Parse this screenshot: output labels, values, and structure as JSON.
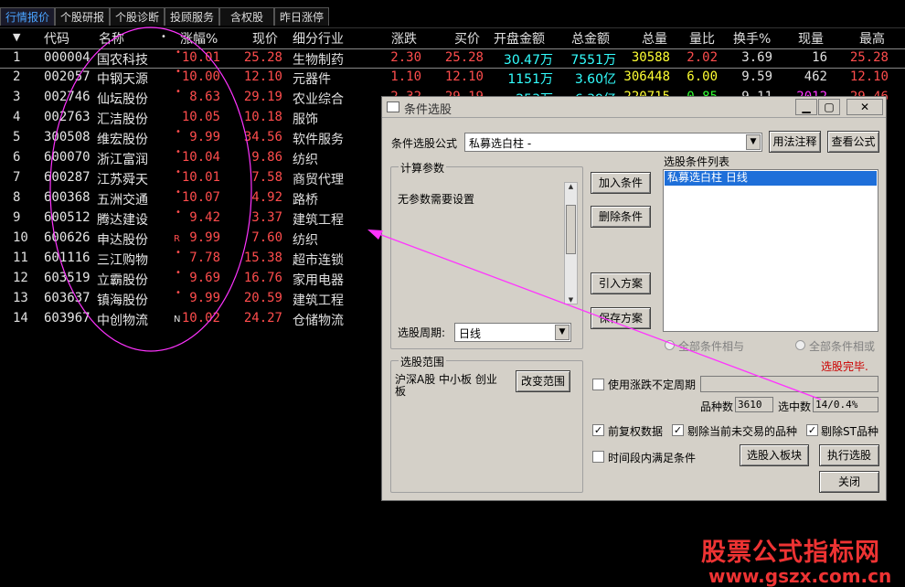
{
  "tabs": [
    {
      "label": "行情报价",
      "active": true
    },
    {
      "label": "个股研报",
      "active": false
    },
    {
      "label": "个股诊断",
      "active": false
    },
    {
      "label": "投顾服务",
      "active": false
    },
    {
      "label": "含权股",
      "active": false
    },
    {
      "label": "昨日涨停",
      "active": false
    }
  ],
  "table": {
    "headers": {
      "sort": "▼",
      "code": "代码",
      "name": "名称",
      "dot": "•",
      "pct": "涨幅%",
      "price": "现价",
      "industry": "细分行业",
      "chg": "涨跌",
      "bid": "买价",
      "open_amt": "开盘金额",
      "total_amt": "总金额",
      "volume": "总量",
      "vol_ratio": "量比",
      "turnover": "换手%",
      "cur_vol": "现量",
      "high": "最高"
    },
    "rows": [
      {
        "idx": "1",
        "code": "000004",
        "name": "国农科技",
        "mark": "•",
        "pct": "10.01",
        "price": "25.28",
        "industry": "生物制药",
        "chg": "2.30",
        "bid": "25.28",
        "open_amt": "30.47万",
        "total_amt": "7551万",
        "volume": "30588",
        "vol_ratio": "2.02",
        "turnover": "3.69",
        "cur_vol": "16",
        "high": "25.28"
      },
      {
        "idx": "2",
        "code": "002057",
        "name": "中钢天源",
        "mark": "•",
        "pct": "10.00",
        "price": "12.10",
        "industry": "元器件",
        "chg": "1.10",
        "bid": "12.10",
        "open_amt": "1151万",
        "total_amt": "3.60亿",
        "volume": "306448",
        "vol_ratio": "6.00",
        "turnover": "9.59",
        "cur_vol": "462",
        "high": "12.10"
      },
      {
        "idx": "3",
        "code": "002746",
        "name": "仙坛股份",
        "mark": "•",
        "pct": "8.63",
        "price": "29.19",
        "industry": "农业综合",
        "chg": "2.32",
        "bid": "29.19",
        "open_amt": "253万",
        "total_amt": "6.39亿",
        "volume": "220715",
        "vol_ratio": "0.85",
        "turnover": "9.11",
        "cur_vol": "2012",
        "high": "29.46"
      },
      {
        "idx": "4",
        "code": "002763",
        "name": "汇洁股份",
        "mark": "",
        "pct": "10.05",
        "price": "10.18",
        "industry": "服饰"
      },
      {
        "idx": "5",
        "code": "300508",
        "name": "维宏股份",
        "mark": "•",
        "pct": "9.99",
        "price": "34.56",
        "industry": "软件服务"
      },
      {
        "idx": "6",
        "code": "600070",
        "name": "浙江富润",
        "mark": "•",
        "pct": "10.04",
        "price": "9.86",
        "industry": "纺织"
      },
      {
        "idx": "7",
        "code": "600287",
        "name": "江苏舜天",
        "mark": "•",
        "pct": "10.01",
        "price": "7.58",
        "industry": "商贸代理"
      },
      {
        "idx": "8",
        "code": "600368",
        "name": "五洲交通",
        "mark": "•",
        "pct": "10.07",
        "price": "4.92",
        "industry": "路桥"
      },
      {
        "idx": "9",
        "code": "600512",
        "name": "腾达建设",
        "mark": "•",
        "pct": "9.42",
        "price": "3.37",
        "industry": "建筑工程"
      },
      {
        "idx": "10",
        "code": "600626",
        "name": "申达股份",
        "mark": "R",
        "pct": "9.99",
        "price": "7.60",
        "industry": "纺织"
      },
      {
        "idx": "11",
        "code": "601116",
        "name": "三江购物",
        "mark": "•",
        "pct": "7.78",
        "price": "15.38",
        "industry": "超市连锁"
      },
      {
        "idx": "12",
        "code": "603519",
        "name": "立霸股份",
        "mark": "•",
        "pct": "9.69",
        "price": "16.76",
        "industry": "家用电器"
      },
      {
        "idx": "13",
        "code": "603637",
        "name": "镇海股份",
        "mark": "•",
        "pct": "9.99",
        "price": "20.59",
        "industry": "建筑工程"
      },
      {
        "idx": "14",
        "code": "603967",
        "name": "中创物流",
        "mark": "N",
        "pct": "10.02",
        "price": "24.27",
        "industry": "仓储物流"
      }
    ]
  },
  "dialog": {
    "title": "条件选股",
    "win_min": "▁",
    "win_max": "▢",
    "win_close": "✕",
    "formula_label": "条件选股公式",
    "formula_value": "私募选白柱   -",
    "dropdown_arrow": "▼",
    "usage_btn": "用法注释",
    "view_btn": "查看公式",
    "params_title": "计算参数",
    "params_text": "无参数需要设置",
    "scroll_up": "▲",
    "scroll_down": "▼",
    "period_label": "选股周期:",
    "period_value": "日线",
    "add_btn": "加入条件",
    "delete_btn": "删除条件",
    "import_btn": "引入方案",
    "save_btn": "保存方案",
    "cond_list_label": "选股条件列表",
    "cond_list": [
      "私募选白柱  日线"
    ],
    "radio_and": "全部条件相与",
    "radio_or": "全部条件相或",
    "status": "选股完毕.",
    "scope_title": "选股范围",
    "scope_text": "沪深A股 中小板 创业板",
    "change_scope_btn": "改变范围",
    "use_period_label": "使用涨跌不定周期",
    "count_label": "品种数",
    "count_value": "3610",
    "selected_label": "选中数",
    "selected_value": "14/0.4%",
    "pre_adj_label": "前复权数据",
    "exclude_untraded_label": "剔除当前未交易的品种",
    "exclude_st_label": "剔除ST品种",
    "time_satisfy_label": "时间段内满足条件",
    "to_block_btn": "选股入板块",
    "execute_btn": "执行选股",
    "close_btn": "关闭",
    "check_mark": "✓"
  },
  "watermark": {
    "line1": "股票公式指标网",
    "line2": "www.gszx.com.cn"
  },
  "colors": {
    "background": "#000000",
    "up_red": "#ff4d4d",
    "volume_yellow": "#ffff33",
    "amount_cyan": "#33ffff",
    "ratio_green": "#33ff33",
    "annotation_magenta": "#ff33ff",
    "dialog_gray": "#d4d0c8",
    "selection_blue": "#1e6fd9"
  }
}
